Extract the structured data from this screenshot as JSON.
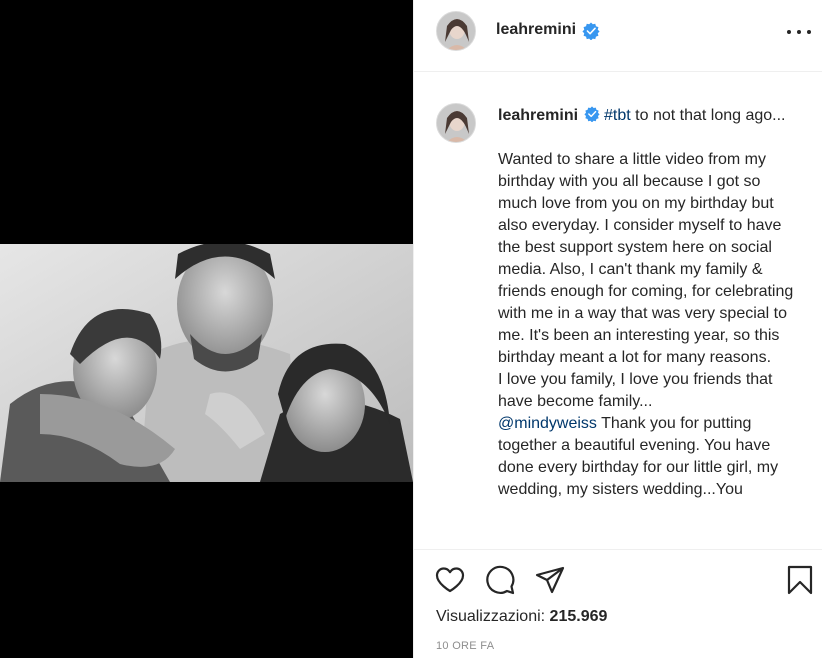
{
  "post": {
    "username": "leahremini",
    "more_icon": "more-horizontal-icon",
    "verified_icon": "verified-badge-icon"
  },
  "caption": {
    "username": "leahremini",
    "hashtag": "#tbt",
    "intro": " to not that long ago...",
    "paragraph1": "Wanted to share a little video from my birthday with you all because I got so much love from you on my birthday but also everyday. I consider myself to have the best support system here on social media. Also, I can't thank my family & friends enough for coming, for celebrating with me in a way that was very special to me. It's been an interesting year, so this birthday meant a lot for many reasons.",
    "paragraph2": "I love you family, I love you friends that have become family...",
    "mention": "@mindyweiss",
    "paragraph3": " Thank you for putting together a beautiful evening. You have done every birthday for our little girl, my wedding, my sisters wedding...You"
  },
  "actions": {
    "like_icon": "heart-icon",
    "comment_icon": "comment-icon",
    "share_icon": "paper-plane-icon",
    "save_icon": "bookmark-icon"
  },
  "stats": {
    "views_label": "Visualizzazioni:",
    "views_count": "215.969",
    "time_ago": "10 ORE FA"
  },
  "colors": {
    "verified": "#3897f0",
    "link": "#00376b",
    "text": "#262626",
    "muted": "#8e8e8e",
    "media_bg": "#000000"
  }
}
